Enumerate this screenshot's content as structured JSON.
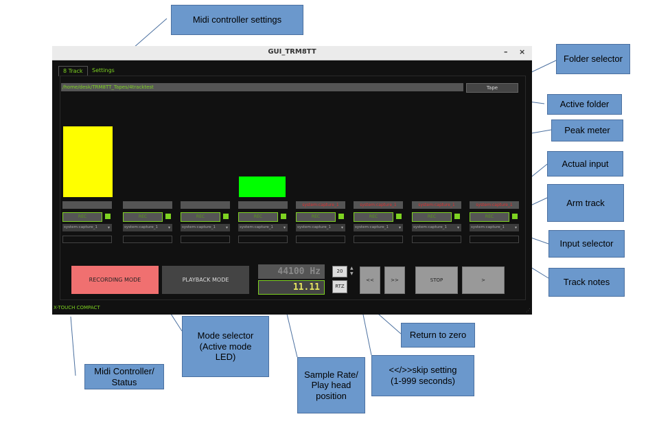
{
  "window": {
    "title": "GUI_TRM8TT",
    "minimize": "–",
    "close": "×"
  },
  "tabs": [
    "8 Track",
    "Settings"
  ],
  "path": "/home/desk/TRM8TT_Tapes/4tracktest",
  "tape_button": "Tape",
  "tracks": [
    {
      "input": "",
      "rec": "REC",
      "select": "system:capture_1"
    },
    {
      "input": "",
      "rec": "REC",
      "select": "system:capture_1"
    },
    {
      "input": "",
      "rec": "REC",
      "select": "system:capture_1"
    },
    {
      "input": "",
      "rec": "REC",
      "select": "system:capture_1"
    },
    {
      "input": "system:capture_1",
      "rec": "REC",
      "select": "system:capture_1"
    },
    {
      "input": "system:capture_1",
      "rec": "REC",
      "select": "system:capture_1"
    },
    {
      "input": "system:capture_1",
      "rec": "REC",
      "select": "system:capture_1"
    },
    {
      "input": "system:capture_1",
      "rec": "REC",
      "select": "system:capture_1"
    }
  ],
  "peak_meters": [
    {
      "level": 0.51,
      "color": "#ffff00"
    },
    {
      "level": 0.0,
      "color": "#00ff00"
    },
    {
      "level": 0.0,
      "color": "#00ff00"
    },
    {
      "level": 0.15,
      "color": "#00ff00"
    },
    {
      "level": 0.0,
      "color": "#00ff00"
    },
    {
      "level": 0.0,
      "color": "#00ff00"
    },
    {
      "level": 0.0,
      "color": "#00ff00"
    },
    {
      "level": 0.0,
      "color": "#00ff00"
    }
  ],
  "transport": {
    "recording_mode": "RECORDING MODE",
    "playback_mode": "PLAYBACK MODE",
    "sample_rate": "44100 Hz",
    "play_head": "11.11",
    "skip_value": "20",
    "rtz": "RTZ",
    "rewind": "<<",
    "forward": ">>",
    "stop": "STOP",
    "play": ">"
  },
  "status": "X-TOUCH COMPACT",
  "callouts": {
    "midi_settings": "Midi controller settings",
    "folder_selector": "Folder selector",
    "active_folder": "Active folder",
    "peak_meter": "Peak meter",
    "actual_input": "Actual input",
    "arm_track": "Arm track",
    "input_selector": "Input selector",
    "track_notes": "Track notes",
    "return_to_zero": "Return to zero",
    "skip_setting_1": "<</>>skip setting",
    "skip_setting_2": "(1-999 seconds)",
    "mode_selector_1": "Mode selector",
    "mode_selector_2": "(Active mode",
    "mode_selector_3": "LED)",
    "midi_status_1": "Midi Controller/",
    "midi_status_2": "Status",
    "sample_rate_1": "Sample Rate/",
    "sample_rate_2": "Play head",
    "sample_rate_3": "position"
  },
  "colors": {
    "accent_green": "#7ed321",
    "rec_red": "#e03030",
    "callout_blue": "#6b98cc",
    "recording_mode_bg": "#f07070"
  }
}
